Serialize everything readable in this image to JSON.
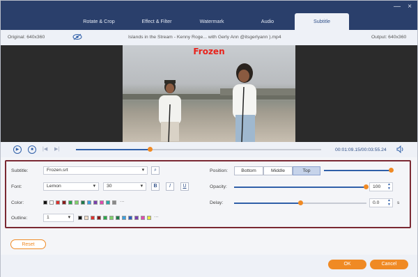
{
  "window": {
    "close": "×",
    "minimize": "—"
  },
  "tabs": [
    "Rotate & Crop",
    "Effect & Filter",
    "Watermark",
    "Audio",
    "Subtitle"
  ],
  "active_tab": 4,
  "info": {
    "original": "Original: 640x360",
    "filename": "Islands in the Stream - Kenny Roge... with Gerly Ann @itsgerlyann ).mp4",
    "output": "Output: 640x360"
  },
  "preview": {
    "subtitle_text": "Frozen"
  },
  "playback": {
    "time": "00:01:09.15/00:03:55.24",
    "progress": 0.3
  },
  "subtitle_panel": {
    "subtitle_label": "Subtitle:",
    "subtitle_file": "Frozen.srt",
    "font_label": "Font:",
    "font_name": "Lemon",
    "font_size": "30",
    "bold": "B",
    "italic": "I",
    "underline": "U",
    "color_label": "Color:",
    "outline_label": "Outline:",
    "outline_value": "1",
    "position_label": "Position:",
    "position_options": [
      "Bottom",
      "Middle",
      "Top"
    ],
    "position_selected": "Top",
    "opacity_label": "Opacity:",
    "opacity_value": "100",
    "delay_label": "Delay:",
    "delay_value": "0.0",
    "delay_unit": "s",
    "more": "···",
    "color_swatches": [
      "#111111",
      "#ffffff",
      "#e0302c",
      "#8a1a1a",
      "#2aa84a",
      "#7fd36a",
      "#1e7a4a",
      "#3aa0e0",
      "#7a3fb0",
      "#e04ab0",
      "#2aa8a8",
      "#8a8a8a"
    ],
    "outline_swatches": [
      "#111111",
      "#f3ddc8",
      "#e0302c",
      "#8a1a1a",
      "#2aa84a",
      "#7fd36a",
      "#1e7a4a",
      "#3aa0e0",
      "#2a5fc0",
      "#7a3fb0",
      "#e04ab0",
      "#e8e83a"
    ]
  },
  "buttons": {
    "reset": "Reset",
    "ok": "OK",
    "cancel": "Cancel"
  },
  "colors": {
    "accent": "#f08a24",
    "titlebar": "#2a3f6b",
    "highlight_border": "#7a2832"
  }
}
